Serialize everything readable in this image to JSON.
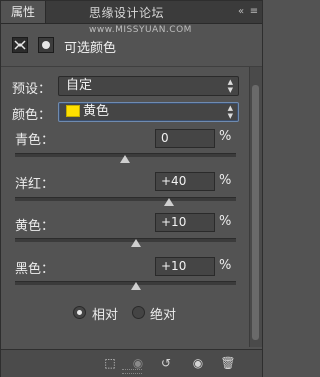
{
  "panel": {
    "tab_title": "属性",
    "watermark": "思缘设计论坛",
    "watermark_url": "www.MISSYUAN.COM"
  },
  "header": {
    "title": "可选颜色"
  },
  "preset": {
    "label": "预设：",
    "value": "自定"
  },
  "colors": {
    "label": "颜色：",
    "value": "黄色",
    "swatch_color": "#ffe000"
  },
  "sliders": [
    {
      "label": "青色：",
      "value": "0",
      "unit": "%",
      "level": 0.5
    },
    {
      "label": "洋红：",
      "value": "+40",
      "unit": "%",
      "level": 0.7
    },
    {
      "label": "黄色：",
      "value": "+10",
      "unit": "%",
      "level": 0.55
    },
    {
      "label": "黑色：",
      "value": "+10",
      "unit": "%",
      "level": 0.55
    }
  ],
  "method": {
    "relative_label": "相对",
    "absolute_label": "绝对",
    "selected": "relative"
  },
  "icons": {
    "titlebar": [
      "collapse-icon",
      "menu-icon"
    ],
    "footer": [
      "clip-to-layer-icon",
      "view-previous-state-icon",
      "reset-icon",
      "visibility-eye-icon",
      "delete-icon"
    ]
  },
  "theme": {
    "panel_bg": "#535353",
    "accent": "#6f8bb0"
  }
}
